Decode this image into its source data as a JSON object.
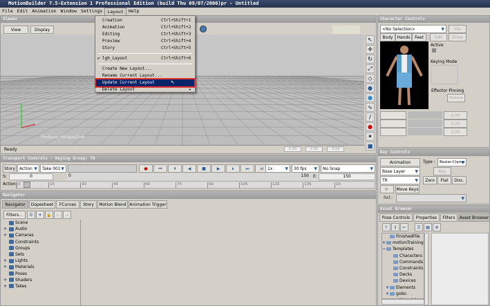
{
  "title": "MotionBuilder 7.5-Extension 1  Professional Edition (build Thu 09/07/2006)pr - Untitled",
  "menubar": [
    "File",
    "Edit",
    "Animation",
    "Window",
    "Settings",
    "Layout",
    "Help"
  ],
  "layout_menu": {
    "items": [
      {
        "label": "Creation",
        "shortcut": "Ctrl+Shift+1"
      },
      {
        "label": "Animation",
        "shortcut": "Ctrl+Shift+2"
      },
      {
        "label": "Editing",
        "shortcut": "Ctrl+Shift+3"
      },
      {
        "label": "Preview",
        "shortcut": "Ctrl+Shift+4"
      },
      {
        "label": "Story",
        "shortcut": "Ctrl+Shift+5"
      },
      {
        "label": "lgh_Layout",
        "shortcut": "Ctrl+Shift+6",
        "checked": true
      },
      {
        "label": "Create New Layout..."
      },
      {
        "label": "Rename Current Layout..."
      },
      {
        "label": "Update Current Layout",
        "highlighted": true
      },
      {
        "label": "Delete Layout",
        "submenu": true
      }
    ]
  },
  "viewer": {
    "title": "Viewer",
    "view_btn": "View",
    "display_btn": "Display",
    "camera_label": "Producer Perspective",
    "axis_x": "X",
    "status": "Ready",
    "values": [
      "0.00",
      "0.00",
      "0.00"
    ]
  },
  "transport": {
    "title": "Transport Controls  -  Keying Group: TR",
    "story": "Story",
    "action": "Action",
    "take": "Take 001",
    "speed": "1x",
    "fps": "30 fps",
    "snap": "No Snap",
    "s_label": "S:",
    "s_value": "0",
    "start": "0",
    "end": "150",
    "e_label": "E:",
    "e_value": "150",
    "action_label": "Action",
    "ticks": [
      "0",
      "15",
      "30",
      "45",
      "60",
      "75",
      "90",
      "105",
      "120",
      "135",
      "15"
    ]
  },
  "navigator": {
    "title": "Navigator",
    "tabs": [
      "Navigator",
      "Dopesheet",
      "FCurves",
      "Story",
      "Motion Blend",
      "Animation Trigger"
    ],
    "filters": "Filters...",
    "tree": [
      {
        "label": "Scene",
        "plus": false
      },
      {
        "label": "Audio",
        "plus": true
      },
      {
        "label": "Cameras",
        "plus": true
      },
      {
        "label": "Constraints",
        "plus": false
      },
      {
        "label": "Groups",
        "plus": false
      },
      {
        "label": "Sets",
        "plus": false
      },
      {
        "label": "Lights",
        "plus": true
      },
      {
        "label": "Materials",
        "plus": true
      },
      {
        "label": "Poses",
        "plus": false
      },
      {
        "label": "Shaders",
        "plus": true
      },
      {
        "label": "Takes",
        "plus": true
      }
    ]
  },
  "character": {
    "title": "Character Controls",
    "selection": "<No Selection>",
    "file": "File",
    "body": "Body",
    "hands": "Hands",
    "feet": "Feet",
    "edit": "Edit",
    "show": "Show",
    "active": "Active",
    "keying_mode": "Keying Mode",
    "effector_pinning": "Effector Pinning",
    "release": "Release",
    "sliders": [
      "0.00",
      "0.00",
      "0.00"
    ]
  },
  "keys": {
    "title": "Key Controls",
    "animation": "Animation",
    "type_label": "Type :",
    "type": "Bezier-Clamp",
    "layer": "Base Layer",
    "tr": "TR",
    "zero": "Zero",
    "flat": "Flat",
    "disc": "Disc.",
    "move_keys": "Move Keys",
    "key": "Key",
    "ref": "Ref.:"
  },
  "assets": {
    "title": "Asset Browser",
    "tabs": [
      "Pose Controls",
      "Properties",
      "Filters",
      "Asset Browser"
    ],
    "tree": [
      {
        "label": "FinishedFile",
        "indent": 1,
        "plus": ""
      },
      {
        "label": "motionTraining",
        "indent": 0,
        "plus": "+"
      },
      {
        "label": "Templates",
        "indent": 0,
        "plus": "-"
      },
      {
        "label": "Characters",
        "indent": 2,
        "plus": ""
      },
      {
        "label": "Commands",
        "indent": 2,
        "plus": ""
      },
      {
        "label": "Constraints",
        "indent": 2,
        "plus": ""
      },
      {
        "label": "Decks",
        "indent": 2,
        "plus": ""
      },
      {
        "label": "Devices",
        "indent": 2,
        "plus": ""
      },
      {
        "label": "Elements",
        "indent": 1,
        "plus": "+"
      },
      {
        "label": "gobo",
        "indent": 1,
        "plus": "+"
      },
      {
        "label": "Materials",
        "indent": 2,
        "plus": ""
      }
    ]
  }
}
